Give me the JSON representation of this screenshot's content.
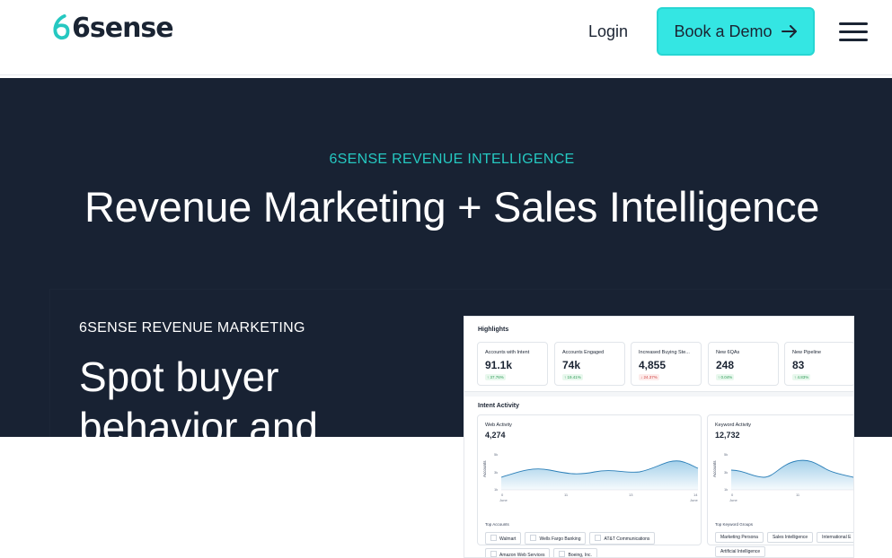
{
  "nav": {
    "logo_text": "6sense",
    "login_label": "Login",
    "demo_label": "Book a Demo",
    "colors": {
      "accent": "#34e6e3",
      "hero_bg": "#182233",
      "brand_teal": "#25c8c1"
    }
  },
  "hero": {
    "eyebrow": "6SENSE REVENUE INTELLIGENCE",
    "title": "Revenue Marketing + Sales Intelligence"
  },
  "card": {
    "eyebrow": "6SENSE REVENUE MARKETING",
    "title": "Spot buyer behavior and"
  },
  "dashboard": {
    "highlights_title": "Highlights",
    "tiles": [
      {
        "label": "Accounts with Intent",
        "value": "91.1k",
        "change": "↑ 37.76%",
        "direction": "up"
      },
      {
        "label": "Accounts Engaged",
        "value": "74k",
        "change": "↑ 19.41%",
        "direction": "up"
      },
      {
        "label": "Increased Buying Ste...",
        "value": "4,855",
        "change": "↓ 24.37%",
        "direction": "down"
      },
      {
        "label": "New 6QAs",
        "value": "248",
        "change": "↑ 0.04%",
        "direction": "up"
      },
      {
        "label": "New Pipeline",
        "value": "83",
        "change": "↑ 4.83%",
        "direction": "up"
      }
    ],
    "intent_title": "Intent Activity",
    "web": {
      "label": "Web Activity",
      "value": "4,274",
      "y_axis": "Accounts",
      "yticks": [
        "5k",
        "3k",
        "1k"
      ],
      "xticks": [
        "0",
        "11",
        "13",
        "14"
      ],
      "xlabel": "June",
      "xlabel_end": "June",
      "top_label": "Top Accounts",
      "chips": [
        "Walmart",
        "Wells Fargo Banking",
        "AT&T Communications",
        "Amazon Web Services",
        "Boeing, Inc."
      ]
    },
    "keyword": {
      "label": "Keyword Activity",
      "value": "12,732",
      "y_axis": "Accounts",
      "yticks": [
        "5k",
        "3k",
        "1k"
      ],
      "xticks": [
        "0",
        "11"
      ],
      "xlabel": "June",
      "top_label": "Top Keyword Groups",
      "chips": [
        "Marketing Persona",
        "Sales Intelligence",
        "International E",
        "Artificial Intelligence"
      ]
    }
  }
}
